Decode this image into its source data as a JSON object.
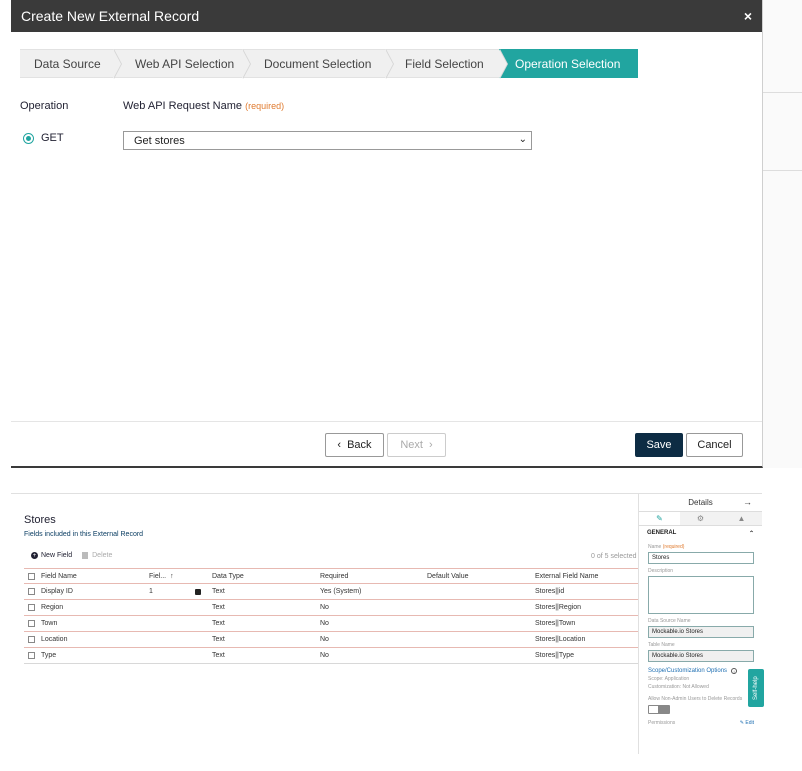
{
  "modal": {
    "title": "Create New External Record",
    "close_glyph": "×",
    "steps": [
      "Data Source",
      "Web API Selection",
      "Document Selection",
      "Field Selection",
      "Operation Selection"
    ],
    "operation_label": "Operation",
    "api_request_label": "Web API Request Name",
    "required_text": "(required)",
    "radio_label": "GET",
    "select_value": "Get stores",
    "back_label": "Back",
    "next_label": "Next",
    "save_label": "Save",
    "cancel_label": "Cancel",
    "accent_color": "#21a5a0",
    "primary_button_color": "#0d2c44"
  },
  "record": {
    "title": "Stores",
    "subtitle": "Fields included in this External Record",
    "new_field_label": "New Field",
    "delete_label": "Delete",
    "selected_count": "0 of 5 selected",
    "columns": [
      "Field Name",
      "Fiel...",
      "Data Type",
      "Required",
      "Default Value",
      "External Field Name"
    ],
    "rows": [
      {
        "name": "Display ID",
        "order": "1",
        "locked": true,
        "type": "Text",
        "required": "Yes (System)",
        "default": "",
        "external": "Stores||id"
      },
      {
        "name": "Region",
        "order": "",
        "locked": false,
        "type": "Text",
        "required": "No",
        "default": "",
        "external": "Stores||Region"
      },
      {
        "name": "Town",
        "order": "",
        "locked": false,
        "type": "Text",
        "required": "No",
        "default": "",
        "external": "Stores||Town"
      },
      {
        "name": "Location",
        "order": "",
        "locked": false,
        "type": "Text",
        "required": "No",
        "default": "",
        "external": "Stores||Location"
      },
      {
        "name": "Type",
        "order": "",
        "locked": false,
        "type": "Text",
        "required": "No",
        "default": "",
        "external": "Stores||Type"
      }
    ]
  },
  "details": {
    "title": "Details",
    "section": "GENERAL",
    "name_label": "Name",
    "name_required": "(required)",
    "name_value": "Stores",
    "description_label": "Description",
    "ds_label": "Data Source Name",
    "ds_value": "Mockable.io Stores",
    "table_label": "Table Name",
    "table_value": "Mockable.io Stores",
    "scope_link": "Scope/Customization Options",
    "scope_text": "Scope: Application",
    "custom_text": "Customization: Not Allowed",
    "allow_delete_label": "Allow Non-Admin Users to Delete Records",
    "permissions_label": "Permissions",
    "edit_label": "Edit",
    "self_help": "Self-help"
  }
}
